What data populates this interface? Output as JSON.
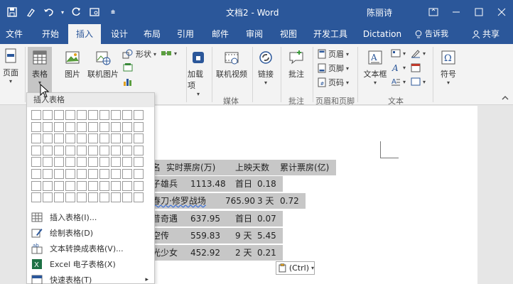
{
  "titlebar": {
    "document_title": "文档2 - Word",
    "user_name": "陈丽诗"
  },
  "tabs": [
    {
      "label": "文件",
      "active": false
    },
    {
      "label": "开始",
      "active": false
    },
    {
      "label": "插入",
      "active": true
    },
    {
      "label": "设计",
      "active": false
    },
    {
      "label": "布局",
      "active": false
    },
    {
      "label": "引用",
      "active": false
    },
    {
      "label": "邮件",
      "active": false
    },
    {
      "label": "审阅",
      "active": false
    },
    {
      "label": "视图",
      "active": false
    },
    {
      "label": "开发工具",
      "active": false
    },
    {
      "label": "Dictation",
      "active": false
    }
  ],
  "tell_me": "告诉我",
  "share": "共享",
  "ribbon": {
    "page": "页面",
    "table": "表格",
    "picture": "图片",
    "online_picture": "联机图片",
    "shapes": "形状",
    "addins": "加载项",
    "online_video": "联机视频",
    "link": "链接",
    "comment": "批注",
    "header": "页眉",
    "footer": "页脚",
    "page_number": "页码",
    "textbox": "文本框",
    "symbol": "符号",
    "groups": {
      "media": "媒体",
      "comments": "批注",
      "header_footer": "页眉和页脚",
      "text": "文本"
    }
  },
  "dropdown": {
    "header": "插入表格",
    "items": [
      {
        "label": "插入表格(I)..."
      },
      {
        "label": "绘制表格(D)"
      },
      {
        "label": "文本转换成表格(V)..."
      },
      {
        "label": "Excel 电子表格(X)"
      },
      {
        "label": "快速表格(T)"
      }
    ]
  },
  "table": {
    "header": {
      "c1": "名",
      "c2": "实时票房(万)",
      "c3": "上映天数",
      "c4": "累计票房(亿)"
    },
    "rows": [
      {
        "name": "子雄兵",
        "box": "1113.48",
        "days": "首日",
        "total": "0.18"
      },
      {
        "name": "春刀·修罗战场",
        "box": "765.90",
        "days": "3 天",
        "total": "0.72"
      },
      {
        "name": "昔奇遇",
        "box": "637.95",
        "days": "首日",
        "total": "0.07"
      },
      {
        "name": "空传",
        "box": "559.83",
        "days": "9 天",
        "total": "5.45"
      },
      {
        "name": "光少女",
        "box": "452.92",
        "days": "2 天",
        "total": "0.21"
      }
    ]
  },
  "paste_options": "(Ctrl)"
}
